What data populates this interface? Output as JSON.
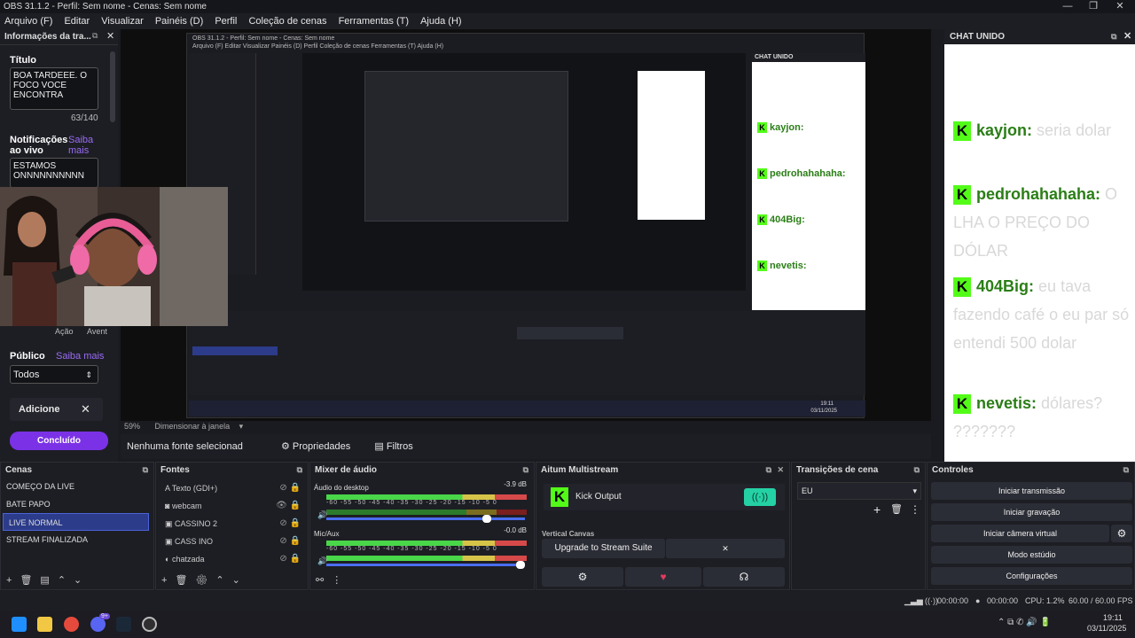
{
  "window": {
    "title": "OBS 31.1.2 - Perfil: Sem nome - Cenas: Sem nome",
    "min": "—",
    "max": "❐",
    "close": "✕"
  },
  "menu": [
    "Arquivo (F)",
    "Editar",
    "Visualizar",
    "Painéis (D)",
    "Perfil",
    "Coleção de cenas",
    "Ferramentas (T)",
    "Ajuda (H)"
  ],
  "left_dock": {
    "title": "Informações da tra...",
    "title_label": "Título",
    "title_value": "BOA TARDEEE. O FOCO VOCE ENCONTRA",
    "counter": "63/140",
    "notif_label": "Notificações ao vivo",
    "notif_link": "Saiba mais",
    "notif_value": "ESTAMOS ONNNNNNNNNN",
    "acao": "Ação",
    "avent": "Avent",
    "publico_label": "Público",
    "publico_link": "Saiba mais",
    "publico_value": "Todos",
    "adicione": "Adicione",
    "done_btn": "Concluído"
  },
  "chat": {
    "header": "CHAT UNIDO",
    "messages": [
      {
        "user": "kayjon:",
        "text": "seria dolar"
      },
      {
        "user": "pedrohahahaha:",
        "text": "O LHA O PREÇO DO DÓLAR"
      },
      {
        "user": "404Big:",
        "text": "eu tava fazendo café o eu par só entendi 500 dolar"
      },
      {
        "user": "nevetis:",
        "text": "dólares? ???????"
      }
    ]
  },
  "preview": {
    "inner_title": "OBS 31.1.2 - Perfil: Sem nome - Cenas: Sem nome",
    "inner_menu": "Arquivo (F)  Editar  Visualizar  Painéis (D)  Perfil  Coleção de cenas  Ferramentas (T)  Ajuda (H)",
    "inner_chat_header": "CHAT UNIDO",
    "zoom": "59%",
    "resize": "Dimensionar à janela",
    "inner_time": "19:11",
    "inner_date": "03/11/2025"
  },
  "status_row": {
    "no_source": "Nenhuma fonte selecionad",
    "properties": "Propriedades",
    "filters": "Filtros"
  },
  "scenes": {
    "title": "Cenas",
    "items": [
      "COMEÇO DA LIVE",
      "BATE PAPO",
      "LIVE NORMAL",
      "STREAM FINALIZADA"
    ],
    "selected_index": 2
  },
  "sources": {
    "title": "Fontes",
    "items": [
      "Texto (GDI+)",
      "webcam",
      "CASSINO 2",
      "CASS INO",
      "chatzada"
    ]
  },
  "mixer": {
    "title": "Mixer de áudio",
    "tracks": [
      {
        "name": "Áudio do desktop",
        "db": "-3.9 dB",
        "level": 0.82
      },
      {
        "name": "Mic/Aux",
        "db": "-0.0 dB",
        "level": 1.0
      }
    ],
    "scale": "-60 -55 -50 -45 -40 -35 -30 -25 -20 -15 -10 -5 0"
  },
  "multistream": {
    "title": "Aitum Multistream",
    "output": "Kick Output",
    "vertical": "Vertical Canvas",
    "upgrade": "Upgrade to Stream Suite",
    "close": "✕"
  },
  "transitions": {
    "title": "Transições de cena",
    "value": "EU"
  },
  "controls": {
    "title": "Controles",
    "buttons": [
      "Iniciar transmissão",
      "Iniciar gravação",
      "Iniciar câmera virtual",
      "Modo estúdio",
      "Configurações"
    ]
  },
  "bottom": {
    "time1": "00:00:00",
    "time2": "00:00:00",
    "cpu": "CPU: 1.2%",
    "fps": "60.00 / 60.00 FPS"
  },
  "taskbar": {
    "time": "19:11",
    "date": "03/11/2025",
    "badge": "9+"
  }
}
